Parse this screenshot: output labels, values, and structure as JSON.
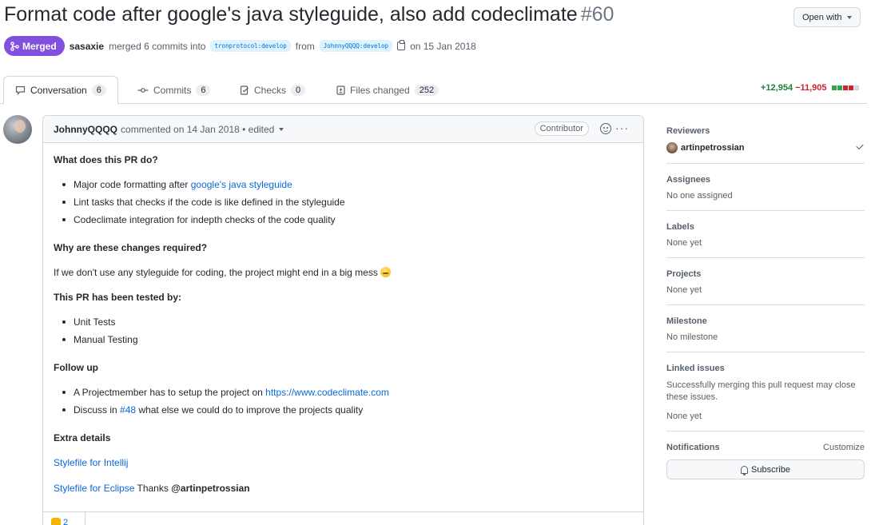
{
  "header": {
    "title": "Format code after google's java styleguide, also add codeclimate",
    "number": "#60",
    "open_with": "Open with"
  },
  "meta": {
    "badge": "Merged",
    "merger": "sasaxie",
    "merged_text": "merged 6 commits into",
    "base_branch": "tronprotocol:develop",
    "from_text": "from",
    "head_branch": "JohnnyQQQQ:develop",
    "date_text": "on 15 Jan 2018"
  },
  "tabs": [
    {
      "label": "Conversation",
      "count": "6"
    },
    {
      "label": "Commits",
      "count": "6"
    },
    {
      "label": "Checks",
      "count": "0"
    },
    {
      "label": "Files changed",
      "count": "252"
    }
  ],
  "diffstat": {
    "additions": "+12,954",
    "deletions": "−11,905",
    "colors": {
      "add": "#2da44e",
      "del": "#cf222e",
      "neutral": "#d0d7de"
    }
  },
  "comment": {
    "author": "JohnnyQQQQ",
    "meta": "commented on 14 Jan 2018 • edited",
    "role": "Contributor",
    "sections": {
      "what_title": "What does this PR do?",
      "what_items": [
        "Major code formatting after ",
        "google's java styleguide",
        "Lint tasks that checks if the code is like defined in the styleguide",
        "Codeclimate integration for indepth checks of the code quality"
      ],
      "why_title": "Why are these changes required?",
      "why_text": "If we don't use any styleguide for coding, the project might end in a big mess",
      "tested_title": "This PR has been tested by:",
      "tested_items": [
        "Unit Tests",
        "Manual Testing"
      ],
      "follow_title": "Follow up",
      "follow_item1_text": "A Projectmember has to setup the project on ",
      "follow_item1_link": "https://www.codeclimate.com",
      "follow_item2_pre": "Discuss in ",
      "follow_item2_link": "#48",
      "follow_item2_post": " what else we could do to improve the projects quality",
      "extra_title": "Extra details",
      "stylefile_intellij": "Stylefile for Intellij",
      "stylefile_eclipse": "Stylefile for Eclipse",
      "thanks_text": " Thanks ",
      "thanks_mention": "@artinpetrossian"
    },
    "reaction_count": "2"
  },
  "sidebar": {
    "reviewers_title": "Reviewers",
    "reviewer": "artinpetrossian",
    "assignees_title": "Assignees",
    "assignees_value": "No one assigned",
    "labels_title": "Labels",
    "labels_value": "None yet",
    "projects_title": "Projects",
    "projects_value": "None yet",
    "milestone_title": "Milestone",
    "milestone_value": "No milestone",
    "linked_title": "Linked issues",
    "linked_note": "Successfully merging this pull request may close these issues.",
    "linked_value": "None yet",
    "notifications_title": "Notifications",
    "customize": "Customize",
    "subscribe": "Subscribe"
  }
}
